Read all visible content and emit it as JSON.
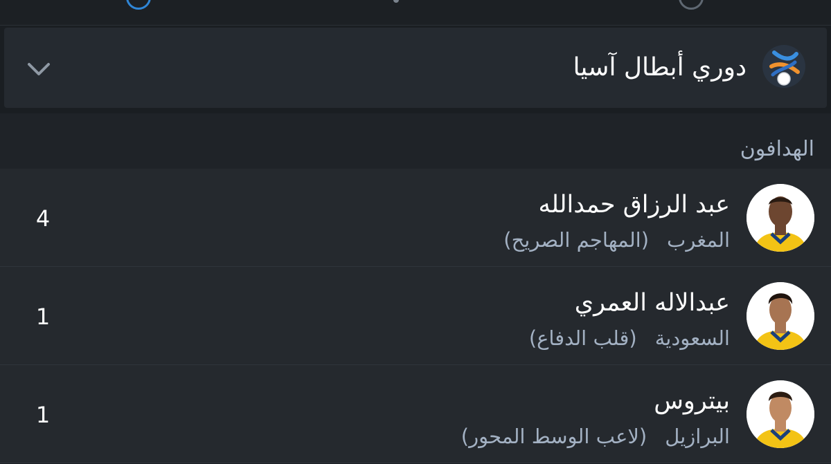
{
  "league": {
    "name": "دوري أبطال آسيا"
  },
  "section": {
    "title": "الهدافون"
  },
  "scorers": [
    {
      "name": "عبد الرزاق حمدالله",
      "country": "المغرب",
      "position": "(المهاجم الصريح)",
      "goals": "4"
    },
    {
      "name": "عبدالاله العمري",
      "country": "السعودية",
      "position": "(قلب الدفاع)",
      "goals": "1"
    },
    {
      "name": "بيتروس",
      "country": "البرازيل",
      "position": "(لاعب الوسط المحور)",
      "goals": "1"
    }
  ],
  "colors": {
    "background": "#1a1e22",
    "card": "#252a30",
    "accent": "#2f86d6",
    "muted_text": "#a3b1c3",
    "jersey": "#f3c315"
  }
}
